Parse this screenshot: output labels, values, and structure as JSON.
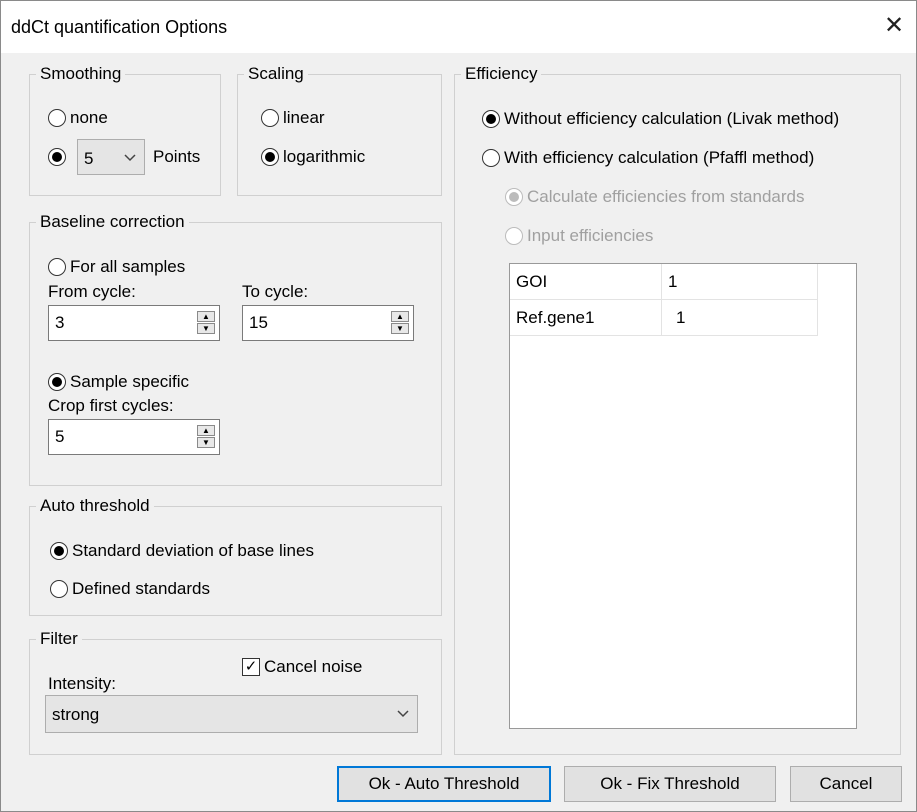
{
  "window": {
    "title": "ddCt quantification Options",
    "close_glyph": "✕"
  },
  "smoothing": {
    "title": "Smoothing",
    "none_label": "none",
    "points_value": "5",
    "points_label": "Points",
    "selected": "points"
  },
  "scaling": {
    "title": "Scaling",
    "linear_label": "linear",
    "log_label": "logarithmic",
    "selected": "logarithmic"
  },
  "baseline": {
    "title": "Baseline correction",
    "all_samples_label": "For all samples",
    "from_cycle_label": "From cycle:",
    "from_cycle_value": "3",
    "to_cycle_label": "To cycle:",
    "to_cycle_value": "15",
    "sample_specific_label": "Sample specific",
    "crop_label": "Crop first cycles:",
    "crop_value": "5",
    "selected": "sample_specific"
  },
  "auto_threshold": {
    "title": "Auto threshold",
    "std_label": "Standard deviation of base lines",
    "defined_label": "Defined standards",
    "selected": "std"
  },
  "filter": {
    "title": "Filter",
    "cancel_noise_label": "Cancel noise",
    "cancel_noise_checked": true,
    "intensity_label": "Intensity:",
    "intensity_value": "strong"
  },
  "efficiency": {
    "title": "Efficiency",
    "without_label": "Without efficiency calculation (Livak method)",
    "with_label": "With efficiency calculation (Pfaffl method)",
    "from_standards_label": "Calculate efficiencies from standards",
    "input_label": "Input efficiencies",
    "selected": "without",
    "table": [
      {
        "gene": "GOI",
        "value": "1"
      },
      {
        "gene": "Ref.gene1",
        "value": "1"
      }
    ]
  },
  "buttons": {
    "ok_auto": "Ok - Auto Threshold",
    "ok_fix": "Ok - Fix Threshold",
    "cancel": "Cancel"
  },
  "icons": {
    "spin_up": "▲",
    "spin_down": "▼",
    "dropdown": "chevron-down-icon",
    "checkmark": "✓"
  }
}
